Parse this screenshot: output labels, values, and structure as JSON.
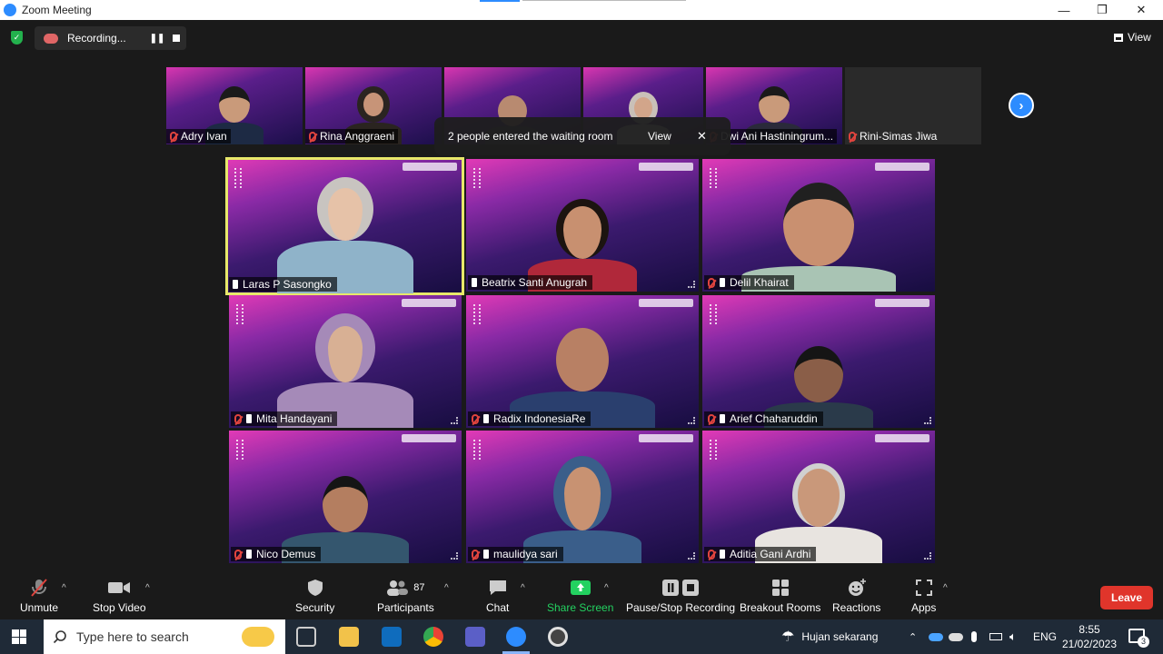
{
  "window": {
    "title": "Zoom Meeting",
    "controls": {
      "minimize": "—",
      "restore": "❐",
      "close": "✕"
    }
  },
  "meeting_bar": {
    "recording_label": "Recording...",
    "view_label": "View"
  },
  "strip": {
    "tiles": [
      {
        "name": "Adry Ivan"
      },
      {
        "name": "Rina Anggraeni"
      },
      {
        "name": ""
      },
      {
        "name": ""
      },
      {
        "name": "Dwi Ani Hastiningrum..."
      },
      {
        "name": "Rini-Simas Jiwa"
      }
    ]
  },
  "toast": {
    "message": "2 people entered the waiting room",
    "view_label": "View",
    "close_label": "✕"
  },
  "gallery": {
    "tiles": [
      {
        "name": "Laras P Sasongko"
      },
      {
        "name": "Beatrix Santi Anugrah"
      },
      {
        "name": "Delil Khairat"
      },
      {
        "name": "Mita Handayani"
      },
      {
        "name": "Radix IndonesiaRe"
      },
      {
        "name": "Arief Chaharuddin"
      },
      {
        "name": "Nico Demus"
      },
      {
        "name": "maulidya sari"
      },
      {
        "name": "Aditia Gani Ardhi"
      }
    ]
  },
  "toolbar": {
    "unmute": "Unmute",
    "stop_video": "Stop Video",
    "security": "Security",
    "participants": "Participants",
    "participants_count": "87",
    "chat": "Chat",
    "share_screen": "Share Screen",
    "pause_recording": "Pause/Stop Recording",
    "breakout_rooms": "Breakout Rooms",
    "reactions": "Reactions",
    "apps": "Apps",
    "leave": "Leave"
  },
  "taskbar": {
    "search_placeholder": "Type here to search",
    "weather": "Hujan sekarang",
    "language": "ENG",
    "time": "8:55",
    "date": "21/02/2023",
    "notification_count": "3"
  },
  "colors": {
    "accent": "#2d8cff",
    "leave": "#e0352b",
    "share": "#23d160",
    "active_speaker": "#e8e86a",
    "mute": "#e0443e"
  }
}
